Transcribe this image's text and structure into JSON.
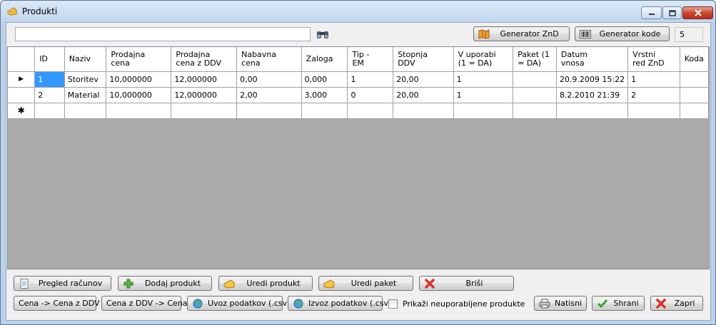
{
  "window": {
    "title": "Produkti"
  },
  "toolbar": {
    "search_value": "",
    "generator_znd": "Generator ZnD",
    "generator_kode": "Generator kode",
    "count": "5"
  },
  "grid": {
    "columns": [
      "ID",
      "Naziv",
      "Prodajna\ncena",
      "Prodajna\ncena z DDV",
      "Nabavna\ncena",
      "Zaloga",
      "Tip -\nEM",
      "Stopnja\nDDV",
      "V uporabi\n(1 = DA)",
      "Paket (1\n= DA)",
      "Datum\nvnosa",
      "Vrstni\nred ZnD",
      "Koda"
    ],
    "rows": [
      [
        "1",
        "Storitev",
        "10,000000",
        "12,000000",
        "0,00",
        "0,000",
        "1",
        "20,00",
        "1",
        "",
        "20.9.2009 15:22",
        "1",
        ""
      ],
      [
        "2",
        "Material",
        "10,000000",
        "12,000000",
        "2,00",
        "3,000",
        "0",
        "20,00",
        "1",
        "",
        "8.2.2010 21:39",
        "2",
        ""
      ]
    ],
    "current_row_marker": "▶",
    "new_row_marker": "✱"
  },
  "buttons": {
    "pregled_racunov": "Pregled računov",
    "dodaj_produkt": "Dodaj produkt",
    "uredi_produkt": "Uredi produkt",
    "uredi_paket": "Uredi paket",
    "brisi": "Briši",
    "cena_to_ddv": "Cena -> Cena z DDV",
    "ddv_to_cena": "Cena z DDV -> Cena",
    "uvoz": "Uvoz podatkov (.csv)",
    "izvoz": "Izvoz podatkov (.csv)",
    "show_unused": "Prikaži neuporabljene produkte",
    "natisni": "Natisni",
    "shrani": "Shrani",
    "zapri": "Zapri"
  },
  "colors": {
    "window_frame": "#bcd2ea",
    "client_bg": "#f0f0f0",
    "grid_empty": "#ababab",
    "close_button": "#c9412a"
  }
}
